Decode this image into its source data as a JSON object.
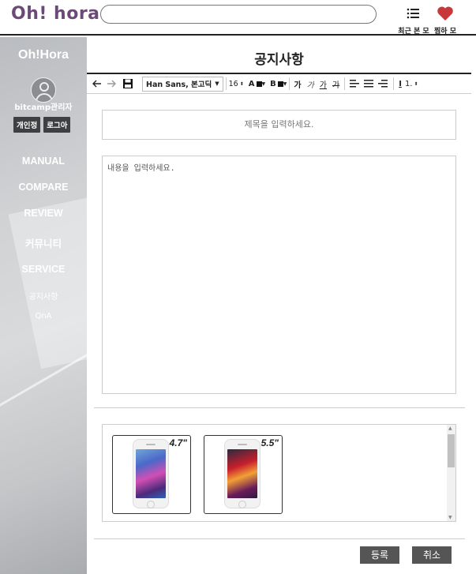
{
  "header": {
    "logo": "Oh! hora",
    "search": {
      "value": "",
      "placeholder": ""
    },
    "recent": {
      "label": "최근 본 모",
      "icon": "list-icon"
    },
    "favorites": {
      "label": "찜하 모",
      "icon": "heart-icon",
      "color": "#c8383a"
    }
  },
  "sidebar": {
    "title": "Oh!Hora",
    "username": "bitcamp관리자",
    "buttons": [
      "개인정",
      "로그아"
    ],
    "menu": [
      "MANUAL",
      "COMPARE",
      "REVIEW",
      "커뮤니티",
      "SERVICE"
    ],
    "submenu": [
      "공지사항",
      "QnA"
    ]
  },
  "main": {
    "title": "공지사항",
    "toolbar": {
      "font": "Han Sans, 본고딕",
      "size": "16",
      "color_label": "A",
      "bg_label": "B",
      "styles": [
        "가",
        "가",
        "가",
        "가"
      ],
      "line_height": "1."
    },
    "title_field": {
      "placeholder": "제목을 입력하세요."
    },
    "body_field": {
      "placeholder": "내용을 입력하세요."
    },
    "gallery": [
      {
        "size": "4.7\""
      },
      {
        "size": "5.5\""
      }
    ],
    "buttons": {
      "submit": "등록",
      "cancel": "취소"
    }
  }
}
